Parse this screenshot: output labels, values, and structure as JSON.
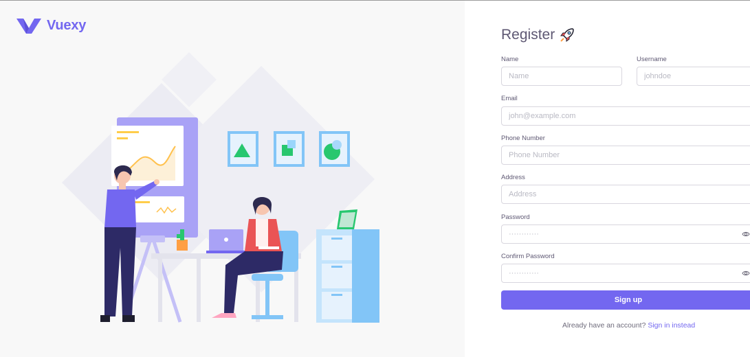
{
  "brand": {
    "name": "Vuexy",
    "color": "#7367f0"
  },
  "register": {
    "title": "Register",
    "fields": {
      "name": {
        "label": "Name",
        "placeholder": "Name",
        "value": ""
      },
      "username": {
        "label": "Username",
        "placeholder": "johndoe",
        "value": ""
      },
      "email": {
        "label": "Email",
        "placeholder": "john@example.com",
        "value": ""
      },
      "phone": {
        "label": "Phone Number",
        "placeholder": "Phone Number",
        "value": ""
      },
      "address": {
        "label": "Address",
        "placeholder": "Address",
        "value": ""
      },
      "password": {
        "label": "Password",
        "placeholder": "············",
        "value": ""
      },
      "confirm_password": {
        "label": "Confirm Password",
        "placeholder": "············",
        "value": ""
      }
    },
    "signup_label": "Sign up",
    "footer_text": "Already have an account?",
    "signin_link": "Sign in instead"
  },
  "icons": {
    "brand": "vuexy-logo-icon",
    "title": "rocket-icon",
    "password_toggle": "eye-icon"
  },
  "colors": {
    "primary": "#7367f0",
    "text": "#5e5873",
    "border": "#d8d6de",
    "panel_bg": "#f8f8f8"
  }
}
